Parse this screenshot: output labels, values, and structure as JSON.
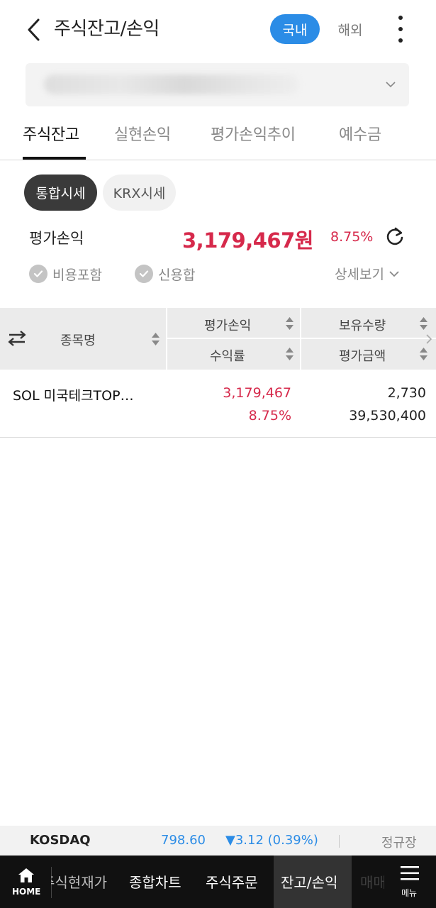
{
  "header": {
    "title": "주식잔고/손익",
    "segment_domestic": "국내",
    "segment_overseas": "해외"
  },
  "tabs": [
    {
      "label": "주식잔고",
      "active": true
    },
    {
      "label": "실현손익",
      "active": false
    },
    {
      "label": "평가손익추이",
      "active": false
    },
    {
      "label": "예수금",
      "active": false
    }
  ],
  "chips": [
    {
      "label": "통합시세",
      "active": true
    },
    {
      "label": "KRX시세",
      "active": false
    }
  ],
  "summary": {
    "label": "평가손익",
    "amount": "3,179,467원",
    "rate": "8.75%",
    "options": [
      "비용포함",
      "신용합"
    ],
    "detail_label": "상세보기"
  },
  "table": {
    "col_name": "종목명",
    "col_pl": "평가손익",
    "col_rate": "수익률",
    "col_qty": "보유수량",
    "col_amount": "평가금액",
    "rows": [
      {
        "name": "SOL 미국테크TOP…",
        "pl": "3,179,467",
        "rate": "8.75%",
        "qty": "2,730",
        "amount": "39,530,400"
      }
    ]
  },
  "ticker": {
    "index": "KOSDAQ",
    "value": "798.60",
    "change": "▼3.12 (0.39%)",
    "market": "정규장"
  },
  "nav": {
    "home_label": "HOME",
    "items": [
      "주식현재가",
      "종합차트",
      "주식주문",
      "잔고/손익",
      "매매"
    ],
    "menu_label": "메뉴"
  },
  "colors": {
    "accent_blue": "#2b8ce6",
    "profit_red": "#d6294b",
    "nav_bg": "#111111"
  }
}
